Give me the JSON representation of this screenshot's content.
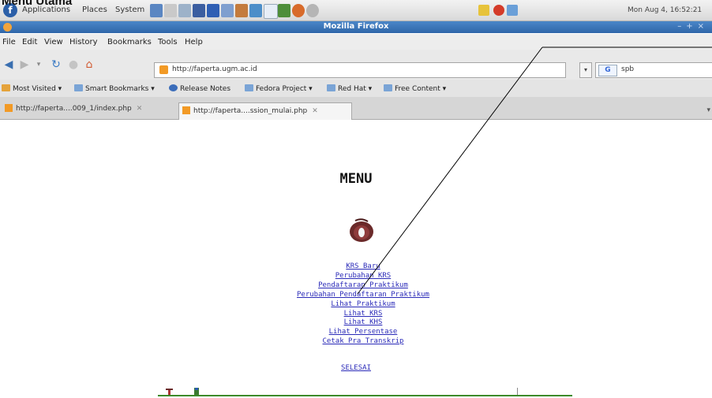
{
  "caption": "Menu Utama",
  "panel": {
    "applications": "Applications",
    "places": "Places",
    "system": "System",
    "clock": "Mon Aug  4, 16:52:21"
  },
  "window": {
    "title": "Mozilla Firefox"
  },
  "menubar": [
    "File",
    "Edit",
    "View",
    "History",
    "Bookmarks",
    "Tools",
    "Help"
  ],
  "navigation": {
    "url": "http://faperta.ugm.ac.id",
    "search_query": "spb",
    "search_engine_glyph": "G"
  },
  "bookmarks": [
    "Most Visited",
    "Smart Bookmarks",
    "Release Notes",
    "Fedora Project",
    "Red Hat",
    "Free Content"
  ],
  "tabs": [
    {
      "label": "http://faperta....009_1/index.php",
      "active": false
    },
    {
      "label": "http://faperta....ssion_mulai.php",
      "active": true
    }
  ],
  "page": {
    "heading": "MENU",
    "links": [
      "KRS Baru",
      "Perubahan KRS",
      "Pendaftaran Praktikum",
      "Perubahan Pendaftaran Praktikum",
      "Lihat Praktikum",
      "Lihat KRS",
      "Lihat KHS",
      "Lihat Persentase",
      "Cetak Pra Transkrip"
    ],
    "logout": "SELESAI"
  },
  "colors": {
    "link": "#2a2ab8",
    "titlebar": "#2f66a9",
    "grass": "#3d8a2a",
    "logo": "#6b2a2a"
  }
}
